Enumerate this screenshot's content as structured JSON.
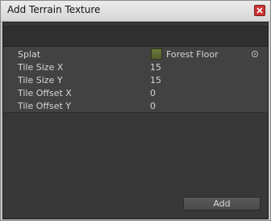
{
  "window": {
    "title": "Add Terrain Texture",
    "close_icon": "close-icon"
  },
  "properties": [
    {
      "label": "Splat",
      "value": "Forest Floor"
    },
    {
      "label": "Tile Size X",
      "value": "15"
    },
    {
      "label": "Tile Size Y",
      "value": "15"
    },
    {
      "label": "Tile Offset X",
      "value": "0"
    },
    {
      "label": "Tile Offset Y",
      "value": "0"
    }
  ],
  "actions": {
    "add_label": "Add"
  },
  "colors": {
    "titlebar": "#dcdcdc",
    "panel": "#383838",
    "text": "#d4d4d4",
    "close": "#cc3333"
  }
}
